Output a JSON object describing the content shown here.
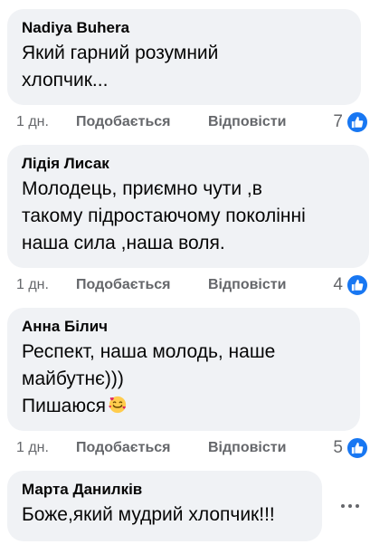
{
  "comments": [
    {
      "author": "Nadiya Buhera",
      "text": "Який гарний розумний\nхлопчик...",
      "time": "1 дн.",
      "like_label": "Подобається",
      "reply_label": "Відповісти",
      "reaction_count": "7",
      "reaction_icon": "thumbs-up-icon"
    },
    {
      "author": "Лідія Лисак",
      "text": "Молодець, приємно чути ,в\nтакому підростаючому поколінні\nнаша сила ,наша воля.",
      "time": "1 дн.",
      "like_label": "Подобається",
      "reply_label": "Відповісти",
      "reaction_count": "4",
      "reaction_icon": "thumbs-up-icon"
    },
    {
      "author": "Анна Білич",
      "text": "Респект, наша молодь, наше\nмайбутнє)))\nПишаюся",
      "emoji": "smiling-face-with-hearts-icon",
      "time": "1 дн.",
      "like_label": "Подобається",
      "reply_label": "Відповісти",
      "reaction_count": "5",
      "reaction_icon": "thumbs-up-icon"
    },
    {
      "author": "Марта Данилків",
      "text": "Боже,який мудрий хлопчик!!!"
    }
  ],
  "colors": {
    "bubble_bg": "#f0f2f5",
    "text": "#050505",
    "secondary_text": "#65676b",
    "like_blue": "#1877f2"
  }
}
